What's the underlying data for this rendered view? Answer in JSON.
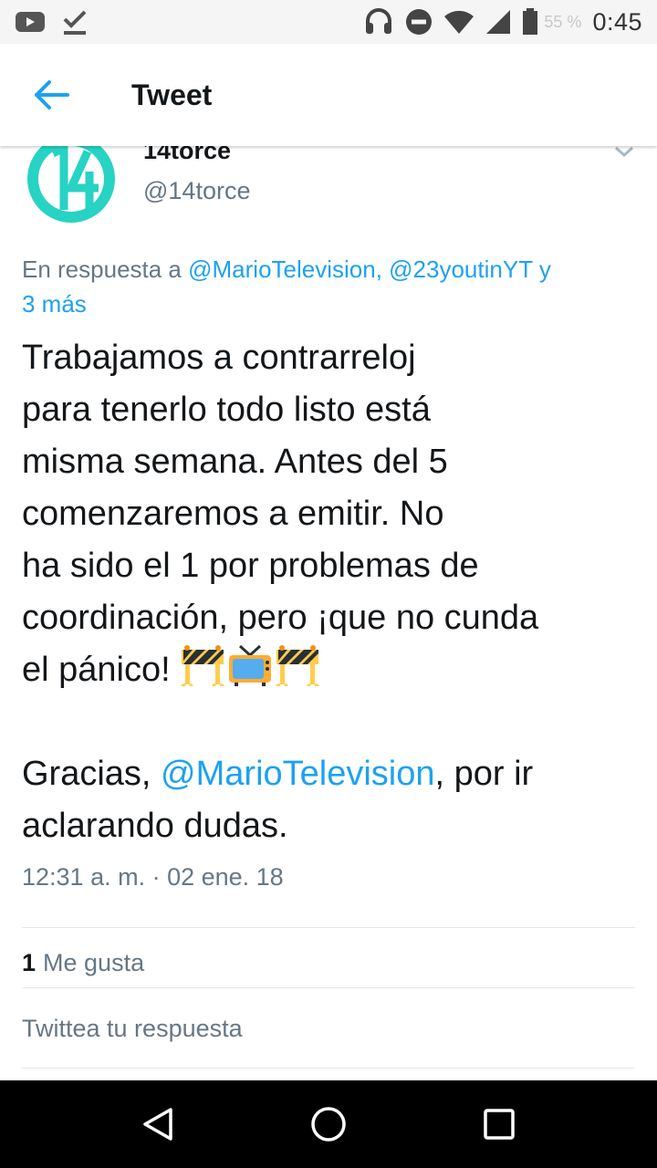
{
  "status_bar": {
    "battery_percent": "55 %",
    "time": "0:45"
  },
  "app_bar": {
    "title": "Tweet"
  },
  "tweet": {
    "author_name": "14torce",
    "author_handle": "@14torce",
    "reply_prefix": "En respuesta a ",
    "reply_mention_1": "@MarioTelevision",
    "reply_sep": ", ",
    "reply_mention_2": "@23youtinYT",
    "reply_suffix_1": " y",
    "reply_suffix_2": "3 más",
    "body_lines": [
      "Trabajamos a contrarreloj",
      "para tenerlo todo listo está",
      "misma semana. Antes del 5",
      "comenzaremos a emitir. No",
      "ha sido el 1 por problemas de",
      "coordinación, pero ¡que no cunda",
      "el pánico! "
    ],
    "body_gracias_prefix": "Gracias, ",
    "body_gracias_mention": "@MarioTelevision",
    "body_gracias_suffix": ", por ir",
    "body_last_line": "aclarando dudas.",
    "emojis": [
      "construction-sign",
      "television",
      "construction-sign"
    ],
    "timestamp": "12:31 a. m. · 02 ene. 18",
    "likes_count": "1",
    "likes_label": "Me gusta"
  },
  "reply_box": {
    "placeholder": "Twittea tu respuesta"
  },
  "colors": {
    "accent": "#1da1f2",
    "avatar": "#27d3c3",
    "muted": "#657786",
    "text": "#14171a"
  },
  "icons": [
    "youtube-icon",
    "check-download-icon",
    "headset-icon",
    "do-not-disturb-icon",
    "wifi-icon",
    "signal-icon",
    "battery-icon",
    "back-arrow-icon",
    "chevron-down-icon",
    "nav-back-icon",
    "nav-home-icon",
    "nav-recents-icon"
  ]
}
